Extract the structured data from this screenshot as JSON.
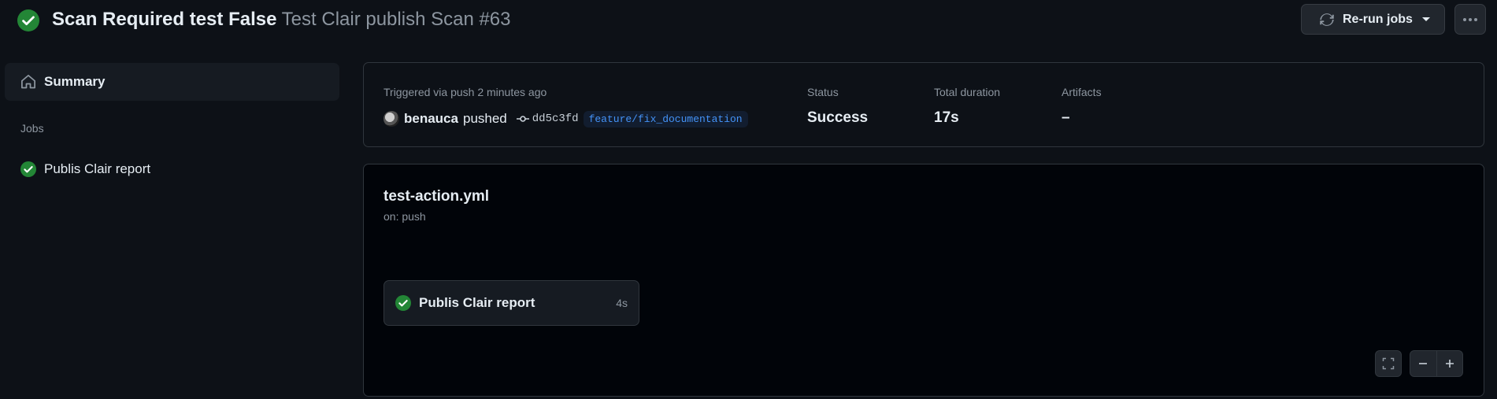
{
  "colors": {
    "success": "#238636",
    "link": "#4493f8",
    "muted": "#8d96a0",
    "background": "#0d1117"
  },
  "header": {
    "status_icon": "check-circle-fill-icon",
    "title_bold": "Scan Required test False",
    "title_light": "Test Clair publish Scan #63",
    "rerun_label": "Re-run jobs",
    "rerun_icon": "sync-icon",
    "more_icon": "kebab-horizontal-icon"
  },
  "sidebar": {
    "summary_label": "Summary",
    "summary_icon": "home-icon",
    "jobs_heading": "Jobs",
    "jobs": [
      {
        "label": "Publis Clair report",
        "status_icon": "check-circle-fill-icon"
      }
    ]
  },
  "summary": {
    "trigger_text": "Triggered via push 2 minutes ago",
    "user": "benauca",
    "action": "pushed",
    "commit_sha": "dd5c3fd",
    "branch": "feature/fix_documentation",
    "status_label": "Status",
    "status_value": "Success",
    "duration_label": "Total duration",
    "duration_value": "17s",
    "artifacts_label": "Artifacts",
    "artifacts_value": "–"
  },
  "workflow": {
    "file": "test-action.yml",
    "trigger": "on: push",
    "jobs": [
      {
        "name": "Publis Clair report",
        "duration": "4s",
        "status_icon": "check-circle-fill-icon"
      }
    ],
    "controls": {
      "fullscreen_icon": "screen-full-icon",
      "zoom_out_icon": "minus-icon",
      "zoom_in_icon": "plus-icon"
    }
  }
}
